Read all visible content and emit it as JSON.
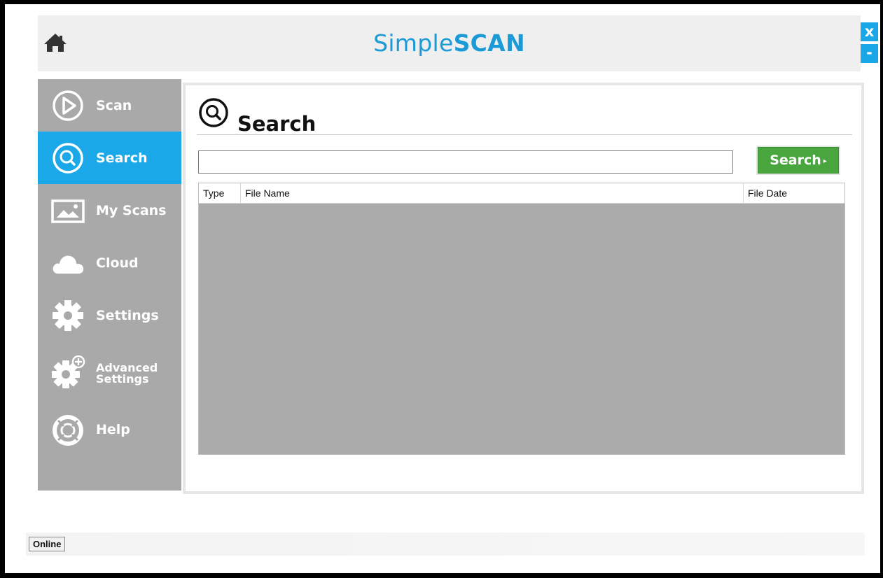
{
  "header": {
    "home_icon": "home-icon",
    "title_light": "Simple",
    "title_bold": "SCAN",
    "title_color": "#1a9ad6"
  },
  "window_controls": {
    "close_label": "x",
    "minimize_label": "-"
  },
  "sidebar": {
    "active_color": "#1ba8e9",
    "items": [
      {
        "label": "Scan",
        "icon": "play-circle-icon",
        "active": false
      },
      {
        "label": "Search",
        "icon": "search-circle-icon",
        "active": true
      },
      {
        "label": "My Scans",
        "icon": "image-icon",
        "active": false
      },
      {
        "label": "Cloud",
        "icon": "cloud-icon",
        "active": false
      },
      {
        "label": "Settings",
        "icon": "gear-icon",
        "active": false
      },
      {
        "label_line1": "Advanced",
        "label_line2": "Settings",
        "icon": "gear-plus-icon",
        "active": false
      },
      {
        "label": "Help",
        "icon": "lifebuoy-icon",
        "active": false
      }
    ]
  },
  "main": {
    "title": "Search",
    "title_icon": "search-circle-icon",
    "search_input_value": "",
    "search_button_label": "Search",
    "search_button_arrow": "▸",
    "search_button_color": "#49a63f",
    "table": {
      "columns": [
        "Type",
        "File Name",
        "File Date"
      ],
      "rows": []
    }
  },
  "statusbar": {
    "status": "Online"
  }
}
